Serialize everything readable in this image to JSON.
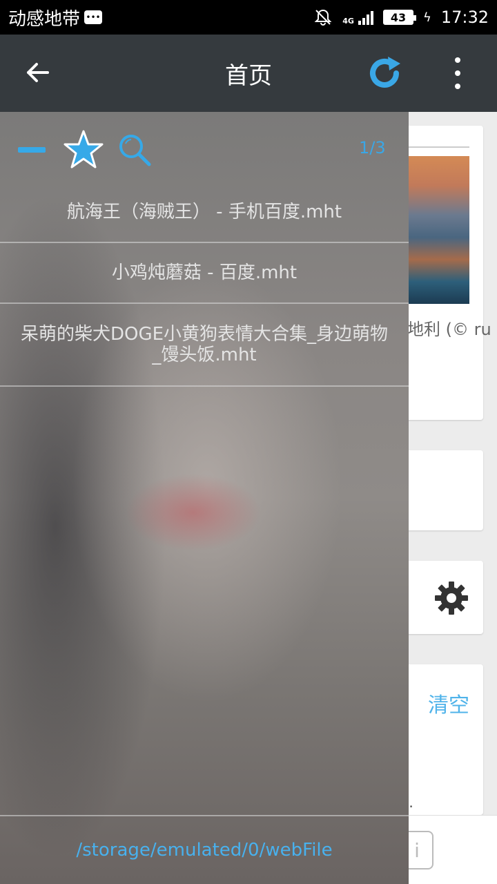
{
  "status_bar": {
    "carrier": "动感地带",
    "network": "4G",
    "battery": "43",
    "time": "17:32"
  },
  "app_bar": {
    "title": "首页"
  },
  "background": {
    "photo_caption": "地利 (© ru",
    "clear_label": "清空",
    "ellipsis": "..",
    "info_label": "i"
  },
  "drawer": {
    "page_indicator": "1/3",
    "files": [
      "航海王（海贼王） - 手机百度.mht",
      "小鸡炖蘑菇 - 百度.mht",
      "呆萌的柴犬DOGE小黄狗表情大合集_身边萌物_馒头饭.mht"
    ],
    "path": "/storage/emulated/0/webFile"
  },
  "colors": {
    "accent": "#36a9e8",
    "app_bar": "#353a3e",
    "status_bar": "#000000"
  },
  "icons": [
    "message-icon",
    "bell-off-icon",
    "signal-icon",
    "battery-icon",
    "back-arrow-icon",
    "refresh-icon",
    "more-vert-icon",
    "minus-icon",
    "star-icon",
    "search-icon",
    "gear-icon",
    "info-icon"
  ]
}
